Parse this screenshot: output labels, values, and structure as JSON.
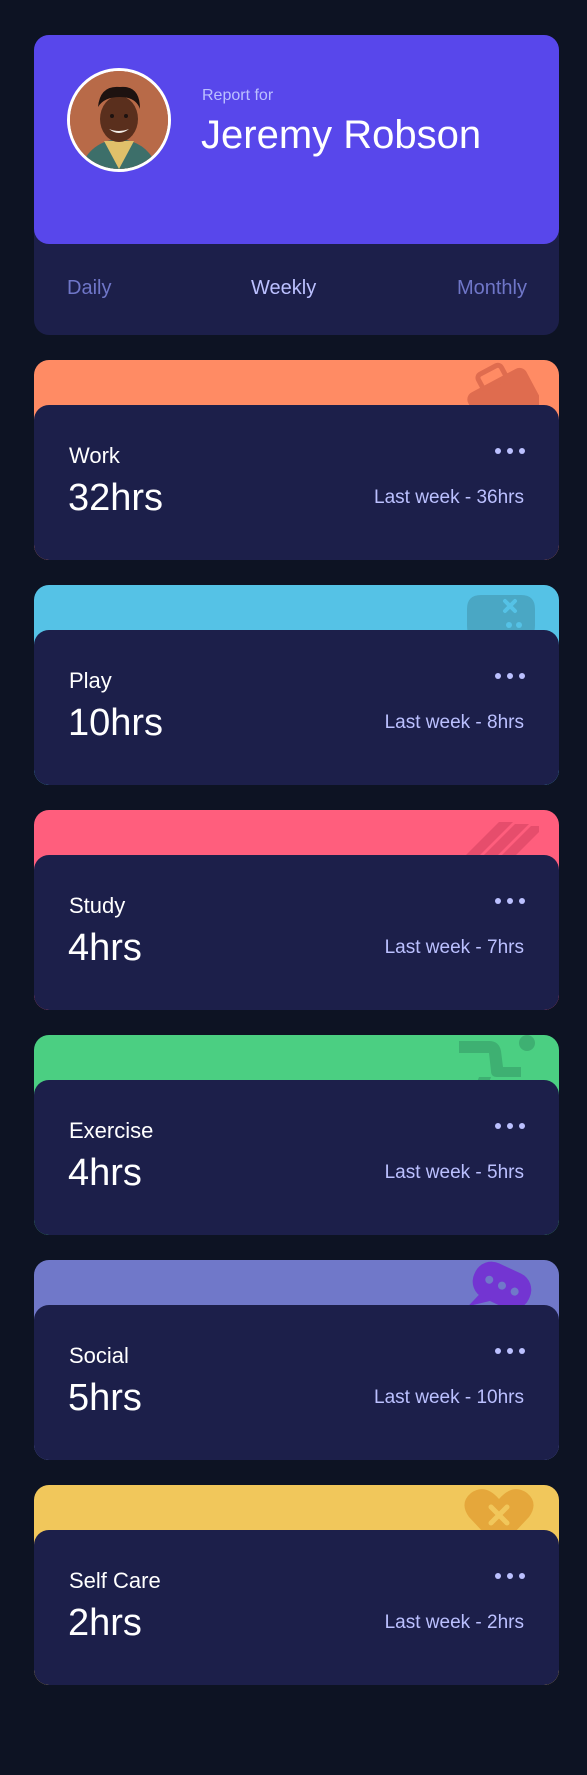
{
  "profile": {
    "report_for": "Report for",
    "name": "Jeremy Robson"
  },
  "tabs": [
    {
      "label": "Daily",
      "active": false
    },
    {
      "label": "Weekly",
      "active": true
    },
    {
      "label": "Monthly",
      "active": false
    }
  ],
  "activities": [
    {
      "title": "Work",
      "hours": "32hrs",
      "previous": "Last week - 36hrs",
      "color": "#ff8b64",
      "icon": "briefcase-icon"
    },
    {
      "title": "Play",
      "hours": "10hrs",
      "previous": "Last week - 8hrs",
      "color": "#55c2e6",
      "icon": "gamepad-icon"
    },
    {
      "title": "Study",
      "hours": "4hrs",
      "previous": "Last week - 7hrs",
      "color": "#ff5e7d",
      "icon": "book-icon"
    },
    {
      "title": "Exercise",
      "hours": "4hrs",
      "previous": "Last week - 5hrs",
      "color": "#4bcf82",
      "icon": "running-icon"
    },
    {
      "title": "Social",
      "hours": "5hrs",
      "previous": "Last week - 10hrs",
      "color": "#7335d2",
      "icon": "chat-icon"
    },
    {
      "title": "Self Care",
      "hours": "2hrs",
      "previous": "Last week - 2hrs",
      "color": "#f1c75b",
      "icon": "heart-icon"
    }
  ],
  "theme": {
    "background": "#0d1323",
    "card": "#1c1f4a",
    "accent": "#5847eb",
    "pale_blue": "#bbc0ff",
    "desaturated_blue": "#6f76c8",
    "social_bg": "#7078c9"
  }
}
